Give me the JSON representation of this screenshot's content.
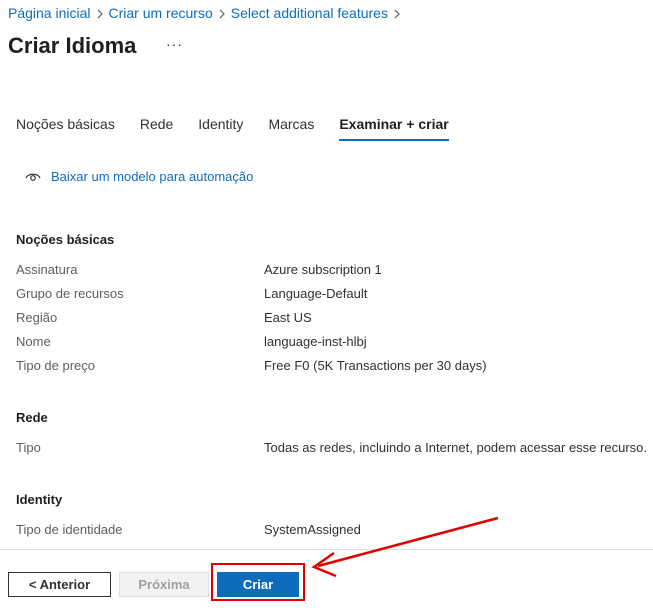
{
  "breadcrumb": [
    "Página inicial",
    "Criar um recurso",
    "Select additional features"
  ],
  "title": "Criar Idioma",
  "more_label": "···",
  "tabs": [
    "Noções básicas",
    "Rede",
    "Identity",
    "Marcas",
    "Examinar + criar"
  ],
  "active_tab": "Examinar + criar",
  "download_link": "Baixar um modelo para automação",
  "sections": {
    "basics": {
      "title": "Noções básicas",
      "rows": [
        {
          "key": "Assinatura",
          "value": "Azure subscription 1"
        },
        {
          "key": "Grupo de recursos",
          "value": "Language-Default"
        },
        {
          "key": "Região",
          "value": "East US"
        },
        {
          "key": "Nome",
          "value": "language-inst-hlbj"
        },
        {
          "key": "Tipo de preço",
          "value": "Free F0 (5K Transactions per 30 days)"
        }
      ]
    },
    "network": {
      "title": "Rede",
      "rows": [
        {
          "key": "Tipo",
          "value": "Todas as redes, incluindo a Internet, podem acessar esse recurso."
        }
      ]
    },
    "identity": {
      "title": "Identity",
      "rows": [
        {
          "key": "Tipo de identidade",
          "value": "SystemAssigned"
        }
      ]
    }
  },
  "footer": {
    "prev_label": "< Anterior",
    "next_label": "Próxima",
    "create_label": "Criar"
  },
  "colors": {
    "link": "#0f6cbd",
    "primary_button": "#0f6cbd",
    "annotation": "#e00000"
  }
}
